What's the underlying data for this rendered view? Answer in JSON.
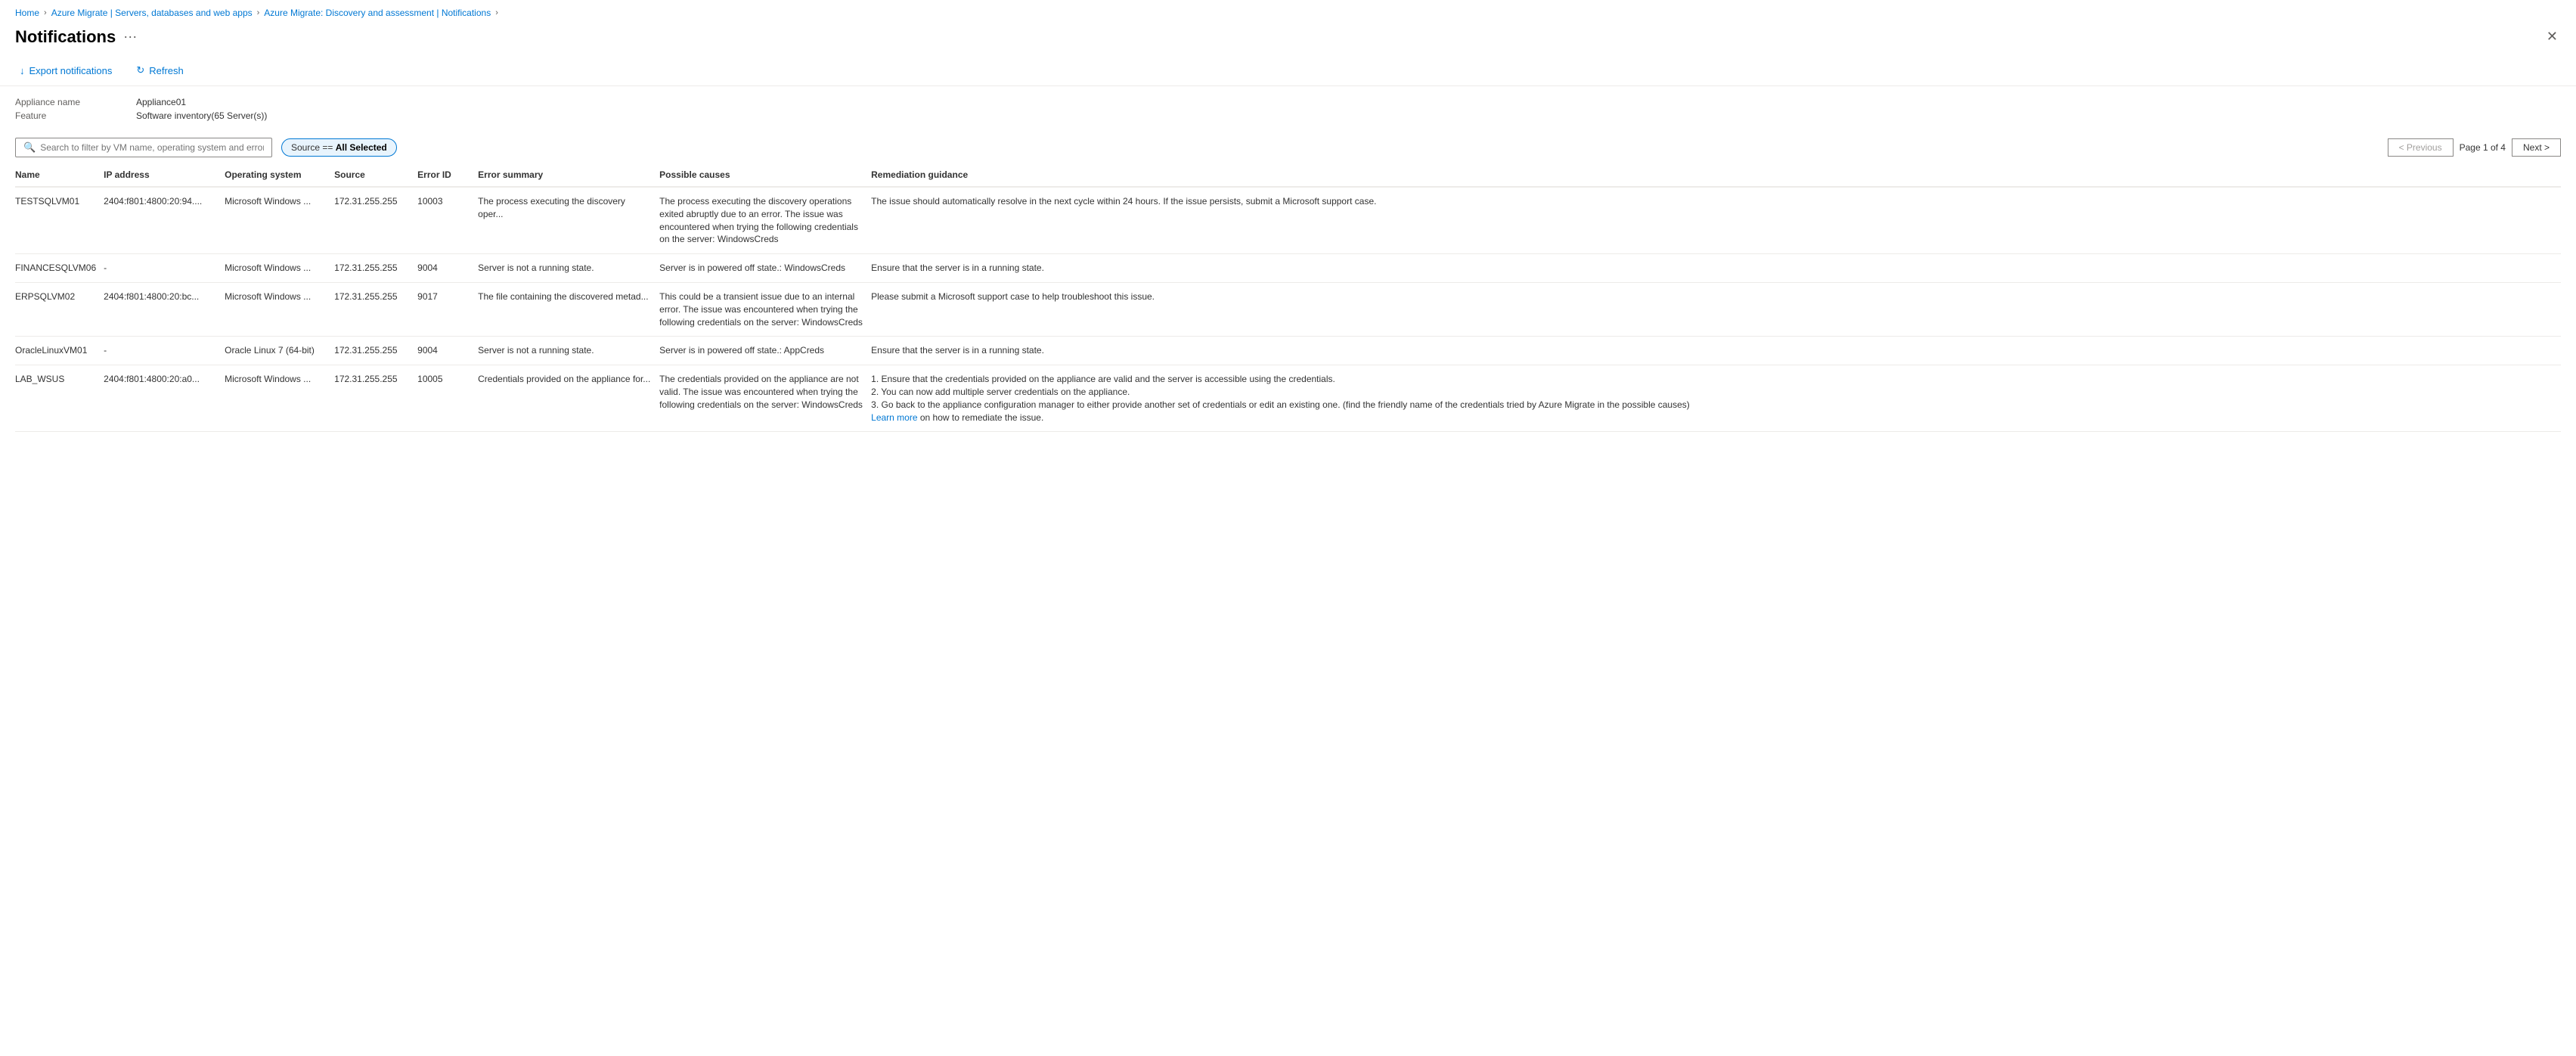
{
  "breadcrumb": {
    "items": [
      {
        "label": "Home",
        "href": "#"
      },
      {
        "label": "Azure Migrate | Servers, databases and web apps",
        "href": "#"
      },
      {
        "label": "Azure Migrate: Discovery and assessment | Notifications",
        "href": "#"
      }
    ]
  },
  "header": {
    "title": "Notifications",
    "more_label": "···",
    "close_label": "✕"
  },
  "toolbar": {
    "export_label": "Export notifications",
    "refresh_label": "Refresh"
  },
  "meta": {
    "appliance_label": "Appliance name",
    "appliance_value": "Appliance01",
    "feature_label": "Feature",
    "feature_value": "Software inventory(65 Server(s))"
  },
  "filter": {
    "search_placeholder": "Search to filter by VM name, operating system and error ID",
    "source_badge": "Source == All Selected"
  },
  "pagination": {
    "previous_label": "< Previous",
    "next_label": "Next >",
    "page_info": "Page 1 of 4"
  },
  "table": {
    "columns": [
      {
        "key": "name",
        "label": "Name"
      },
      {
        "key": "ip",
        "label": "IP address"
      },
      {
        "key": "os",
        "label": "Operating system"
      },
      {
        "key": "source",
        "label": "Source"
      },
      {
        "key": "error_id",
        "label": "Error ID"
      },
      {
        "key": "error_summary",
        "label": "Error summary"
      },
      {
        "key": "possible_causes",
        "label": "Possible causes"
      },
      {
        "key": "remediation",
        "label": "Remediation guidance"
      }
    ],
    "rows": [
      {
        "name": "TESTSQLVM01",
        "ip": "2404:f801:4800:20:94....",
        "os": "Microsoft Windows ...",
        "source": "172.31.255.255",
        "error_id": "10003",
        "error_summary": "The process executing the discovery oper...",
        "possible_causes": "The process executing the discovery operations exited abruptly due to an error. The issue was encountered when trying the following credentials on the server: WindowsCreds",
        "remediation": "The issue should automatically resolve in the next cycle within 24 hours. If the issue persists, submit a Microsoft support case."
      },
      {
        "name": "FINANCESQLVM06",
        "ip": "-",
        "os": "Microsoft Windows ...",
        "source": "172.31.255.255",
        "error_id": "9004",
        "error_summary": "Server is not a running state.",
        "possible_causes": "Server is in powered off state.: WindowsCreds",
        "remediation": "Ensure that the server is in a running state."
      },
      {
        "name": "ERPSQLVM02",
        "ip": "2404:f801:4800:20:bc...",
        "os": "Microsoft Windows ...",
        "source": "172.31.255.255",
        "error_id": "9017",
        "error_summary": "The file containing the discovered metad...",
        "possible_causes": "This could be a transient issue due to an internal error. The issue was encountered when trying the following credentials on the server: WindowsCreds",
        "remediation": "Please submit a Microsoft support case to help troubleshoot this issue."
      },
      {
        "name": "OracleLinuxVM01",
        "ip": "-",
        "os": "Oracle Linux 7 (64-bit)",
        "source": "172.31.255.255",
        "error_id": "9004",
        "error_summary": "Server is not a running state.",
        "possible_causes": "Server is in powered off state.: AppCreds",
        "remediation": "Ensure that the server is in a running state."
      },
      {
        "name": "LAB_WSUS",
        "ip": "2404:f801:4800:20:a0...",
        "os": "Microsoft Windows ...",
        "source": "172.31.255.255",
        "error_id": "10005",
        "error_summary": "Credentials provided on the appliance for...",
        "possible_causes": "The credentials provided on the appliance are not valid. The issue was encountered when trying the following credentials on the server: WindowsCreds",
        "remediation_parts": [
          "1. Ensure that the credentials provided on the appliance are valid and the server is accessible using the credentials.",
          "2. You can now add multiple server credentials on the appliance.",
          "3. Go back to the appliance configuration manager to either provide another set of credentials or edit an existing one. (find the friendly name of the credentials tried by Azure Migrate in the possible causes)"
        ],
        "remediation_link": "Learn more",
        "remediation_link_suffix": " on how to remediate the issue."
      }
    ]
  }
}
